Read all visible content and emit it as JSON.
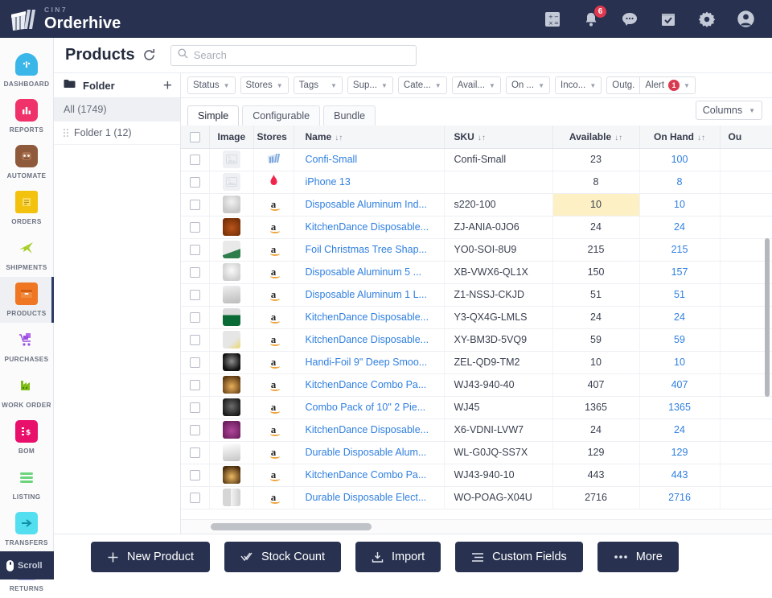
{
  "brand": {
    "sub": "CIN7",
    "name": "Orderhive"
  },
  "topbar": {
    "icons": [
      {
        "name": "calculator-icon",
        "glyph": "calculator"
      },
      {
        "name": "notifications-bell-icon",
        "glyph": "bell",
        "badge": "6"
      },
      {
        "name": "chat-icon",
        "glyph": "chat"
      },
      {
        "name": "tasks-calendar-icon",
        "glyph": "calendar-check"
      },
      {
        "name": "settings-gear-icon",
        "glyph": "gear"
      },
      {
        "name": "user-account-icon",
        "glyph": "avatar"
      }
    ]
  },
  "sidebar": {
    "items": [
      {
        "label": "DASHBOARD",
        "icon": "dashboard-icon",
        "color": "#3bb6e8",
        "glyph": "◔",
        "active": false
      },
      {
        "label": "REPORTS",
        "icon": "reports-icon",
        "color": "#f0326a",
        "glyph": "▐",
        "active": false
      },
      {
        "label": "AUTOMATE",
        "icon": "automate-icon",
        "color": "#8f5a3c",
        "glyph": "■",
        "active": false
      },
      {
        "label": "ORDERS",
        "icon": "orders-icon",
        "color": "#f2c20e",
        "glyph": "≡",
        "active": false
      },
      {
        "label": "SHIPMENTS",
        "icon": "shipments-icon",
        "color": "#a8cf2a",
        "glyph": "✈",
        "active": false
      },
      {
        "label": "PRODUCTS",
        "icon": "products-icon",
        "color": "#ef7622",
        "glyph": "▬",
        "active": true
      },
      {
        "label": "PURCHASES",
        "icon": "purchases-icon",
        "color": "#9a4fe0",
        "glyph": "▶",
        "active": false
      },
      {
        "label": "WORK ORDER",
        "icon": "work-order-icon",
        "color": "#7dbd17",
        "glyph": "▲",
        "active": false
      },
      {
        "label": "BOM",
        "icon": "bom-icon",
        "color": "#e8106b",
        "glyph": "$",
        "active": false
      },
      {
        "label": "LISTING",
        "icon": "listing-icon",
        "color": "#6dd47e",
        "glyph": "☰",
        "active": false
      },
      {
        "label": "TRANSFERS",
        "icon": "transfers-icon",
        "color": "#22c4d8",
        "glyph": "⇄",
        "active": false
      },
      {
        "label": "RETURNS",
        "icon": "returns-icon",
        "color": "#7b7be8",
        "glyph": "↷",
        "active": false
      }
    ],
    "scroll_chip": "Scroll"
  },
  "header": {
    "title": "Products",
    "refresh_icon": "refresh-icon",
    "search": {
      "value": "",
      "placeholder": "Search"
    }
  },
  "folder_panel": {
    "title": "Folder",
    "add_label": "+",
    "rows": [
      {
        "label": "All (1749)",
        "selected": true
      },
      {
        "label": "Folder 1 (12)",
        "selected": false
      }
    ]
  },
  "filters": [
    {
      "label": "Status",
      "caret": true,
      "badge": null
    },
    {
      "label": "Stores",
      "caret": true,
      "badge": null
    },
    {
      "label": "Tags",
      "caret": true,
      "badge": null
    },
    {
      "label": "Sup...",
      "caret": true,
      "badge": null
    },
    {
      "label": "Cate...",
      "caret": true,
      "badge": null
    },
    {
      "label": "Avail...",
      "caret": true,
      "badge": null
    },
    {
      "label": "On ...",
      "caret": true,
      "badge": null
    },
    {
      "label": "Inco...",
      "caret": true,
      "badge": null
    },
    {
      "label": "Outg.",
      "caret": false,
      "badge": null
    },
    {
      "label": "Alert",
      "caret": true,
      "badge": "1"
    }
  ],
  "tabs": [
    {
      "label": "Simple",
      "active": true
    },
    {
      "label": "Configurable",
      "active": false
    },
    {
      "label": "Bundle",
      "active": false
    }
  ],
  "columns_button": "Columns",
  "table": {
    "headers": [
      {
        "label": "",
        "key": "check"
      },
      {
        "label": "Image",
        "key": "image"
      },
      {
        "label": "Stores",
        "key": "stores"
      },
      {
        "label": "Name",
        "key": "name",
        "sort": "↓↑"
      },
      {
        "label": "SKU",
        "key": "sku",
        "sort": "↓↑"
      },
      {
        "label": "Available",
        "key": "available",
        "sort": "↓↑"
      },
      {
        "label": "On Hand",
        "key": "onhand",
        "sort": "↓↑"
      },
      {
        "label": "Ou",
        "key": "out",
        "sort": ""
      }
    ],
    "rows": [
      {
        "image": "placeholder",
        "store": "other-store-icon",
        "name": "Confi-Small",
        "sku": "Confi-Small",
        "available": "23",
        "onhand": "100",
        "alert": false
      },
      {
        "image": "placeholder",
        "store": "flame-store-icon",
        "name": "iPhone 13",
        "sku": "",
        "available": "8",
        "onhand": "8",
        "alert": false
      },
      {
        "image": "cup",
        "store": "amazon-icon",
        "name": "Disposable Aluminum Ind...",
        "sku": "s220-100",
        "available": "10",
        "onhand": "10",
        "alert": true
      },
      {
        "image": "bowl-brown",
        "store": "amazon-icon",
        "name": "KitchenDance Disposable...",
        "sku": "ZJ-ANIA-0JO6",
        "available": "24",
        "onhand": "24",
        "alert": false
      },
      {
        "image": "foil-tray",
        "store": "amazon-icon",
        "name": "Foil Christmas Tree Shap...",
        "sku": "YO0-SOI-8U9",
        "available": "215",
        "onhand": "215",
        "alert": false
      },
      {
        "image": "cup-small",
        "store": "amazon-icon",
        "name": "Disposable Aluminum 5 ...",
        "sku": "XB-VWX6-QL1X",
        "available": "150",
        "onhand": "157",
        "alert": false
      },
      {
        "image": "pan",
        "store": "amazon-icon",
        "name": "Disposable Aluminum 1 L...",
        "sku": "Z1-NSSJ-CKJD",
        "available": "51",
        "onhand": "51",
        "alert": false
      },
      {
        "image": "bowl-green",
        "store": "amazon-icon",
        "name": "KitchenDance Disposable...",
        "sku": "Y3-QX4G-LMLS",
        "available": "24",
        "onhand": "24",
        "alert": false
      },
      {
        "image": "cups-pack",
        "store": "amazon-icon",
        "name": "KitchenDance Disposable...",
        "sku": "XY-BM3D-5VQ9",
        "available": "59",
        "onhand": "59",
        "alert": false
      },
      {
        "image": "dark-pan",
        "store": "amazon-icon",
        "name": "Handi-Foil 9\" Deep Smoo...",
        "sku": "ZEL-QD9-TM2",
        "available": "10",
        "onhand": "10",
        "alert": false
      },
      {
        "image": "combo",
        "store": "amazon-icon",
        "name": "KitchenDance Combo Pa...",
        "sku": "WJ43-940-40",
        "available": "407",
        "onhand": "407",
        "alert": false
      },
      {
        "image": "dark-bowl",
        "store": "amazon-icon",
        "name": "Combo Pack of 10\" 2 Pie...",
        "sku": "WJ45",
        "available": "1365",
        "onhand": "1365",
        "alert": false
      },
      {
        "image": "purple-cup",
        "store": "amazon-icon",
        "name": "KitchenDance Disposable...",
        "sku": "X6-VDNI-LVW7",
        "available": "24",
        "onhand": "24",
        "alert": false
      },
      {
        "image": "white-scoop",
        "store": "amazon-icon",
        "name": "Durable Disposable Alum...",
        "sku": "WL-G0JQ-SS7X",
        "available": "129",
        "onhand": "129",
        "alert": false
      },
      {
        "image": "combo2",
        "store": "amazon-icon",
        "name": "KitchenDance Combo Pa...",
        "sku": "WJ43-940-10",
        "available": "443",
        "onhand": "443",
        "alert": false
      },
      {
        "image": "two-cups",
        "store": "amazon-icon",
        "name": "Durable Disposable Elect...",
        "sku": "WO-POAG-X04U",
        "available": "2716",
        "onhand": "2716",
        "alert": false
      }
    ]
  },
  "bottom_actions": [
    {
      "label": "New Product",
      "icon": "plus-icon"
    },
    {
      "label": "Stock Count",
      "icon": "check-list-icon"
    },
    {
      "label": "Import",
      "icon": "download-icon"
    },
    {
      "label": "Custom Fields",
      "icon": "lines-icon"
    },
    {
      "label": "More",
      "icon": "ellipsis-icon"
    }
  ],
  "colors": {
    "navy": "#283250",
    "link_blue": "#2f7fe0",
    "alert_yellow": "#fcf0c4",
    "badge_red": "#e0394f"
  }
}
